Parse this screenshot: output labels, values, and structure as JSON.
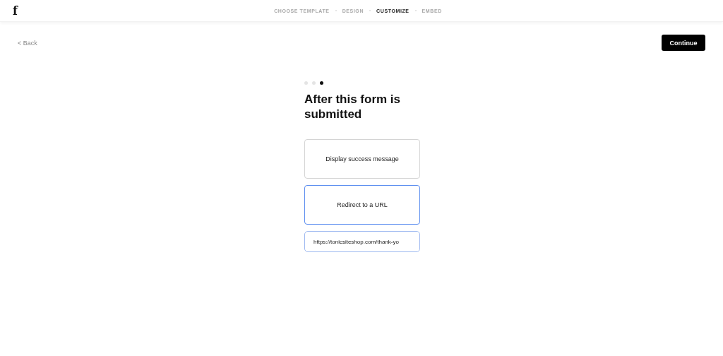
{
  "logo": {
    "text": "f"
  },
  "steps": [
    {
      "label": "CHOOSE TEMPLATE",
      "selected": false
    },
    {
      "label": "DESIGN",
      "selected": false
    },
    {
      "label": "CUSTOMIZE",
      "selected": true
    },
    {
      "label": "EMBED",
      "selected": false
    }
  ],
  "back_link": "< Back",
  "continue_button": "Continue",
  "page_dots": [
    {
      "selected": false
    },
    {
      "selected": false
    },
    {
      "selected": true
    }
  ],
  "heading": "After this form is submitted",
  "options": [
    {
      "label": "Display success message",
      "selected": false
    },
    {
      "label": "Redirect to a URL",
      "selected": true
    }
  ],
  "url_field": {
    "value": "https://tonicsiteshop.com/thank-yo"
  }
}
